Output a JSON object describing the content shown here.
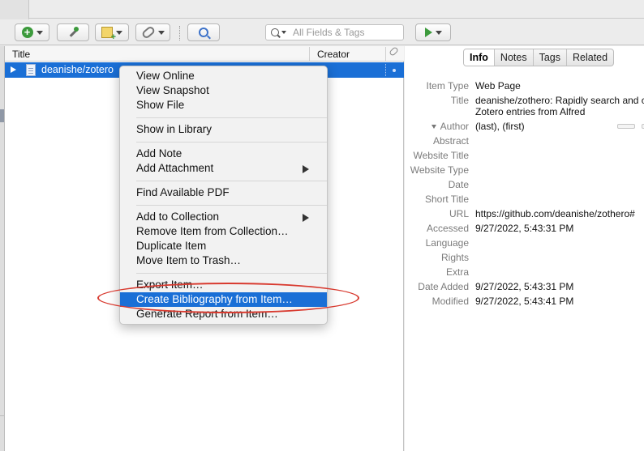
{
  "toolbar": {
    "search_placeholder": "All Fields & Tags"
  },
  "items": {
    "columns": {
      "title": "Title",
      "creator": "Creator"
    },
    "selected_row_title": "deanishe/zotero"
  },
  "context_menu": {
    "view_online": "View Online",
    "view_snapshot": "View Snapshot",
    "show_file": "Show File",
    "show_in_library": "Show in Library",
    "add_note": "Add Note",
    "add_attachment": "Add Attachment",
    "find_pdf": "Find Available PDF",
    "add_to_collection": "Add to Collection",
    "remove_from_collection": "Remove Item from Collection…",
    "duplicate": "Duplicate Item",
    "move_to_trash": "Move Item to Trash…",
    "export_item": "Export Item…",
    "create_bibliography": "Create Bibliography from Item…",
    "generate_report": "Generate Report from Item…"
  },
  "tabs": {
    "info": "Info",
    "notes": "Notes",
    "tags": "Tags",
    "related": "Related"
  },
  "info": {
    "item_type_label": "Item Type",
    "item_type": "Web Page",
    "title_label": "Title",
    "title_line1": "deanishe/zothero: Rapidly search and c",
    "title_line2": "Zotero entries from Alfred",
    "author_label": "Author",
    "author": "(last), (first)",
    "abstract_label": "Abstract",
    "website_title_label": "Website Title",
    "website_type_label": "Website Type",
    "date_label": "Date",
    "short_title_label": "Short Title",
    "url_label": "URL",
    "url": "https://github.com/deanishe/zothero#",
    "accessed_label": "Accessed",
    "accessed": "9/27/2022, 5:43:31 PM",
    "language_label": "Language",
    "rights_label": "Rights",
    "extra_label": "Extra",
    "date_added_label": "Date Added",
    "date_added": "9/27/2022, 5:43:31 PM",
    "modified_label": "Modified",
    "modified": "9/27/2022, 5:43:41 PM"
  },
  "colors": {
    "selection": "#1a6fd6",
    "annotation": "#d83a2f"
  }
}
